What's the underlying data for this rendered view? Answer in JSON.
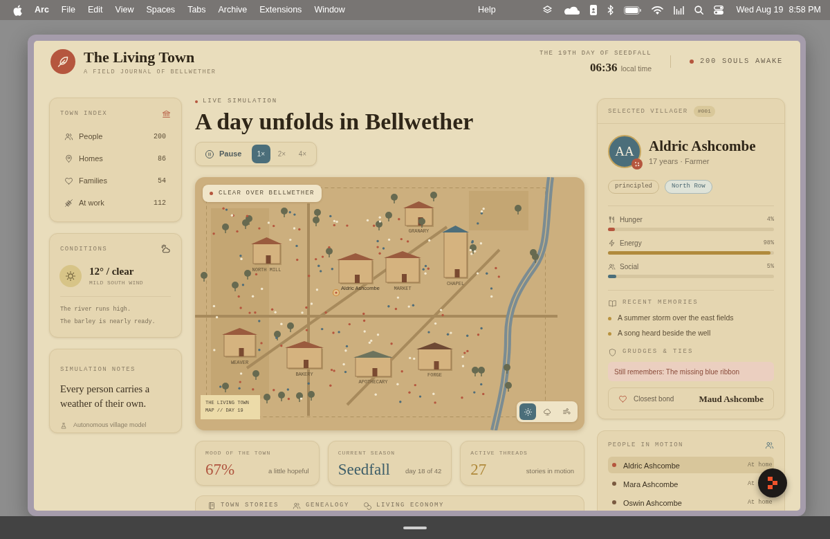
{
  "menu_bar": {
    "app": "Arc",
    "menus": [
      "File",
      "Edit",
      "View",
      "Spaces",
      "Tabs",
      "Archive",
      "Extensions",
      "Window"
    ],
    "help": "Help",
    "date": "Wed Aug 19",
    "time": "8:58 PM"
  },
  "header": {
    "title": "The Living Town",
    "subtitle": "A FIELD JOURNAL OF BELLWETHER",
    "day": "THE 19TH DAY OF SEEDFALL",
    "clock": "06:36",
    "clock_note": "local time",
    "population": "200 SOULS AWAKE"
  },
  "town_index": {
    "title": "TOWN INDEX",
    "items": [
      {
        "kind": "people",
        "label": "People",
        "value": "200"
      },
      {
        "kind": "homes",
        "label": "Homes",
        "value": "86"
      },
      {
        "kind": "families",
        "label": "Families",
        "value": "54"
      },
      {
        "kind": "work",
        "label": "At work",
        "value": "112"
      }
    ]
  },
  "conditions": {
    "title": "CONDITIONS",
    "summary": "12° / clear",
    "wind": "MILD SOUTH WIND",
    "notes": [
      "The river runs high.",
      "The barley is nearly ready."
    ]
  },
  "simulation_notes": {
    "title": "SIMULATION NOTES",
    "quote": "Every person carries a weather of their own.",
    "footer": "Autonomous village model"
  },
  "simulation": {
    "eyebrow": "LIVE SIMULATION",
    "heading": "A day unfolds in Bellwether",
    "pause_label": "Pause",
    "speeds": [
      {
        "label": "1×",
        "selected": true
      },
      {
        "label": "2×",
        "selected": false
      },
      {
        "label": "4×",
        "selected": false
      }
    ]
  },
  "map": {
    "weather_badge": "CLEAR OVER BELLWETHER",
    "buildings": [
      {
        "label": "NORTH MILL",
        "color": "#9a5b3e"
      },
      {
        "label": "GRANARY",
        "color": "#9a5b3e"
      },
      {
        "color": "#9a5b3e"
      },
      {
        "label": "MARKET",
        "color": "#9a5b3e"
      },
      {
        "label": "CHAPEL",
        "color": "#4d6e7a"
      },
      {
        "label": "WEAVER",
        "color": "#9a5b3e"
      },
      {
        "label": "BAKERY",
        "color": "#9a5b3e"
      },
      {
        "label": "APOTHECARY",
        "color": "#6d735d"
      },
      {
        "label": "FORGE",
        "color": "#6e4934"
      }
    ],
    "villager_label": "Aldric Ashcombe",
    "legend": [
      "THE LIVING TOWN",
      "MAP // DAY 19"
    ],
    "weather_modes": [
      {
        "kind": "sun",
        "selected": true
      },
      {
        "kind": "rain",
        "selected": false
      },
      {
        "kind": "wind",
        "selected": false
      }
    ]
  },
  "stats": [
    {
      "label": "MOOD OF THE TOWN",
      "value": "67%",
      "note": "a little hopeful",
      "color": "#b0553f"
    },
    {
      "label": "CURRENT SEASON",
      "value": "Seedfall",
      "note": "day 18 of 42",
      "color": "#3f5f69"
    },
    {
      "label": "ACTIVE THREADS",
      "value": "27",
      "note": "stories in motion",
      "color": "#b08a3c"
    }
  ],
  "tabs": [
    {
      "kind": "stories",
      "label": "TOWN STORIES"
    },
    {
      "kind": "genealogy",
      "label": "GENEALOGY"
    },
    {
      "kind": "economy",
      "label": "LIVING ECONOMY"
    }
  ],
  "villager": {
    "title": "SELECTED VILLAGER",
    "id": "#001",
    "initials": "AA",
    "name": "Aldric Ashcombe",
    "details": "17 years · Farmer",
    "tags": [
      {
        "kind": "trait",
        "label": "principled"
      },
      {
        "kind": "place",
        "label": "North Row"
      }
    ],
    "needs": [
      {
        "kind": "hunger",
        "label": "Hunger",
        "reading": "4%",
        "level": 0.04,
        "color": "#b5563e"
      },
      {
        "kind": "energy",
        "label": "Energy",
        "reading": "98%",
        "level": 0.98,
        "color": "#b08a3c"
      },
      {
        "kind": "social",
        "label": "Social",
        "reading": "5%",
        "level": 0.05,
        "color": "#4b6e7a"
      }
    ],
    "memories_title": "RECENT MEMORIES",
    "memories": [
      "A summer storm over the east fields",
      "A song heard beside the well"
    ],
    "ties_title": "GRUDGES & TIES",
    "grudge": "Still remembers: The missing blue ribbon",
    "bond_label": "Closest bond",
    "bond_name": "Maud Ashcombe"
  },
  "people_in_motion": {
    "title": "PEOPLE IN MOTION",
    "people": [
      {
        "name": "Aldric Ashcombe",
        "status": "At home",
        "selected": true,
        "color": "#b5563e"
      },
      {
        "name": "Mara Ashcombe",
        "status": "At",
        "selected": false,
        "color": "#7a5a40"
      },
      {
        "name": "Oswin Ashcombe",
        "status": "At home",
        "selected": false,
        "color": "#7a5a40"
      }
    ]
  }
}
